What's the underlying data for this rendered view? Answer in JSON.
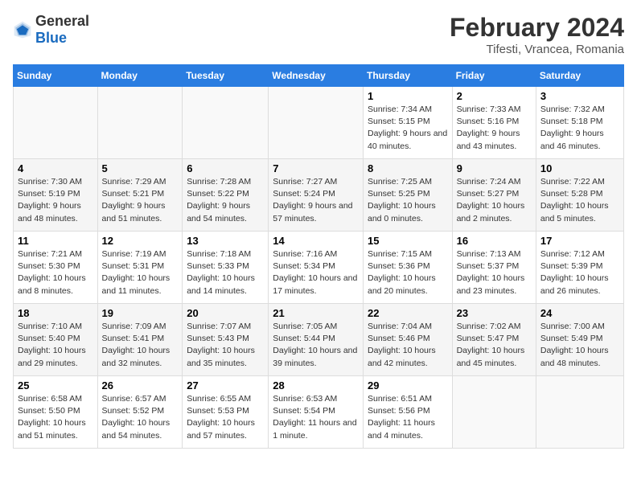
{
  "logo": {
    "general": "General",
    "blue": "Blue"
  },
  "header": {
    "title": "February 2024",
    "subtitle": "Tifesti, Vrancea, Romania"
  },
  "columns": [
    "Sunday",
    "Monday",
    "Tuesday",
    "Wednesday",
    "Thursday",
    "Friday",
    "Saturday"
  ],
  "weeks": [
    [
      {
        "day": "",
        "empty": true
      },
      {
        "day": "",
        "empty": true
      },
      {
        "day": "",
        "empty": true
      },
      {
        "day": "",
        "empty": true
      },
      {
        "day": "1",
        "sunrise": "Sunrise: 7:34 AM",
        "sunset": "Sunset: 5:15 PM",
        "daylight": "Daylight: 9 hours and 40 minutes."
      },
      {
        "day": "2",
        "sunrise": "Sunrise: 7:33 AM",
        "sunset": "Sunset: 5:16 PM",
        "daylight": "Daylight: 9 hours and 43 minutes."
      },
      {
        "day": "3",
        "sunrise": "Sunrise: 7:32 AM",
        "sunset": "Sunset: 5:18 PM",
        "daylight": "Daylight: 9 hours and 46 minutes."
      }
    ],
    [
      {
        "day": "4",
        "sunrise": "Sunrise: 7:30 AM",
        "sunset": "Sunset: 5:19 PM",
        "daylight": "Daylight: 9 hours and 48 minutes."
      },
      {
        "day": "5",
        "sunrise": "Sunrise: 7:29 AM",
        "sunset": "Sunset: 5:21 PM",
        "daylight": "Daylight: 9 hours and 51 minutes."
      },
      {
        "day": "6",
        "sunrise": "Sunrise: 7:28 AM",
        "sunset": "Sunset: 5:22 PM",
        "daylight": "Daylight: 9 hours and 54 minutes."
      },
      {
        "day": "7",
        "sunrise": "Sunrise: 7:27 AM",
        "sunset": "Sunset: 5:24 PM",
        "daylight": "Daylight: 9 hours and 57 minutes."
      },
      {
        "day": "8",
        "sunrise": "Sunrise: 7:25 AM",
        "sunset": "Sunset: 5:25 PM",
        "daylight": "Daylight: 10 hours and 0 minutes."
      },
      {
        "day": "9",
        "sunrise": "Sunrise: 7:24 AM",
        "sunset": "Sunset: 5:27 PM",
        "daylight": "Daylight: 10 hours and 2 minutes."
      },
      {
        "day": "10",
        "sunrise": "Sunrise: 7:22 AM",
        "sunset": "Sunset: 5:28 PM",
        "daylight": "Daylight: 10 hours and 5 minutes."
      }
    ],
    [
      {
        "day": "11",
        "sunrise": "Sunrise: 7:21 AM",
        "sunset": "Sunset: 5:30 PM",
        "daylight": "Daylight: 10 hours and 8 minutes."
      },
      {
        "day": "12",
        "sunrise": "Sunrise: 7:19 AM",
        "sunset": "Sunset: 5:31 PM",
        "daylight": "Daylight: 10 hours and 11 minutes."
      },
      {
        "day": "13",
        "sunrise": "Sunrise: 7:18 AM",
        "sunset": "Sunset: 5:33 PM",
        "daylight": "Daylight: 10 hours and 14 minutes."
      },
      {
        "day": "14",
        "sunrise": "Sunrise: 7:16 AM",
        "sunset": "Sunset: 5:34 PM",
        "daylight": "Daylight: 10 hours and 17 minutes."
      },
      {
        "day": "15",
        "sunrise": "Sunrise: 7:15 AM",
        "sunset": "Sunset: 5:36 PM",
        "daylight": "Daylight: 10 hours and 20 minutes."
      },
      {
        "day": "16",
        "sunrise": "Sunrise: 7:13 AM",
        "sunset": "Sunset: 5:37 PM",
        "daylight": "Daylight: 10 hours and 23 minutes."
      },
      {
        "day": "17",
        "sunrise": "Sunrise: 7:12 AM",
        "sunset": "Sunset: 5:39 PM",
        "daylight": "Daylight: 10 hours and 26 minutes."
      }
    ],
    [
      {
        "day": "18",
        "sunrise": "Sunrise: 7:10 AM",
        "sunset": "Sunset: 5:40 PM",
        "daylight": "Daylight: 10 hours and 29 minutes."
      },
      {
        "day": "19",
        "sunrise": "Sunrise: 7:09 AM",
        "sunset": "Sunset: 5:41 PM",
        "daylight": "Daylight: 10 hours and 32 minutes."
      },
      {
        "day": "20",
        "sunrise": "Sunrise: 7:07 AM",
        "sunset": "Sunset: 5:43 PM",
        "daylight": "Daylight: 10 hours and 35 minutes."
      },
      {
        "day": "21",
        "sunrise": "Sunrise: 7:05 AM",
        "sunset": "Sunset: 5:44 PM",
        "daylight": "Daylight: 10 hours and 39 minutes."
      },
      {
        "day": "22",
        "sunrise": "Sunrise: 7:04 AM",
        "sunset": "Sunset: 5:46 PM",
        "daylight": "Daylight: 10 hours and 42 minutes."
      },
      {
        "day": "23",
        "sunrise": "Sunrise: 7:02 AM",
        "sunset": "Sunset: 5:47 PM",
        "daylight": "Daylight: 10 hours and 45 minutes."
      },
      {
        "day": "24",
        "sunrise": "Sunrise: 7:00 AM",
        "sunset": "Sunset: 5:49 PM",
        "daylight": "Daylight: 10 hours and 48 minutes."
      }
    ],
    [
      {
        "day": "25",
        "sunrise": "Sunrise: 6:58 AM",
        "sunset": "Sunset: 5:50 PM",
        "daylight": "Daylight: 10 hours and 51 minutes."
      },
      {
        "day": "26",
        "sunrise": "Sunrise: 6:57 AM",
        "sunset": "Sunset: 5:52 PM",
        "daylight": "Daylight: 10 hours and 54 minutes."
      },
      {
        "day": "27",
        "sunrise": "Sunrise: 6:55 AM",
        "sunset": "Sunset: 5:53 PM",
        "daylight": "Daylight: 10 hours and 57 minutes."
      },
      {
        "day": "28",
        "sunrise": "Sunrise: 6:53 AM",
        "sunset": "Sunset: 5:54 PM",
        "daylight": "Daylight: 11 hours and 1 minute."
      },
      {
        "day": "29",
        "sunrise": "Sunrise: 6:51 AM",
        "sunset": "Sunset: 5:56 PM",
        "daylight": "Daylight: 11 hours and 4 minutes."
      },
      {
        "day": "",
        "empty": true
      },
      {
        "day": "",
        "empty": true
      }
    ]
  ]
}
